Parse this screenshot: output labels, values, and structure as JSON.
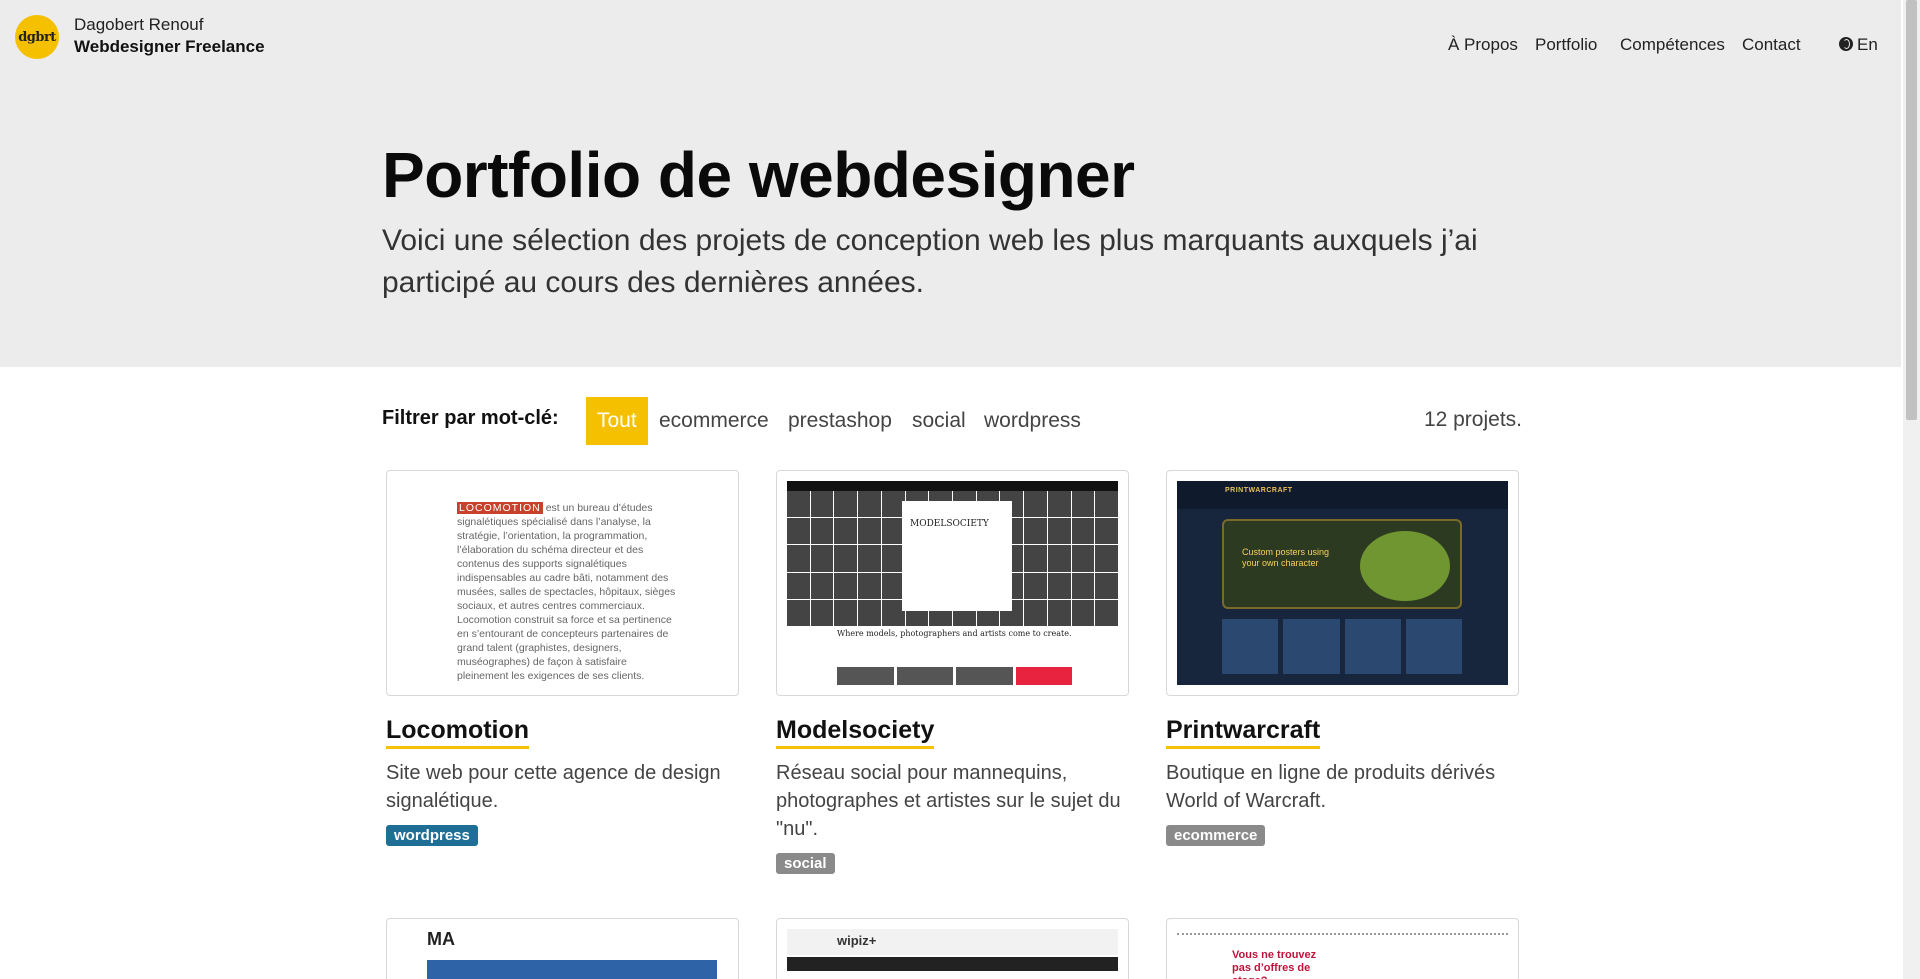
{
  "brand": {
    "logo_text": "dgbrt",
    "name": "Dagobert Renouf",
    "role": "Webdesigner Freelance"
  },
  "nav": {
    "items": [
      {
        "label": "À Propos"
      },
      {
        "label": "Portfolio"
      },
      {
        "label": "Compétences"
      },
      {
        "label": "Contact"
      }
    ],
    "language": {
      "label": "En",
      "icon": "globe-icon"
    }
  },
  "hero": {
    "title": "Portfolio de webdesigner",
    "subtitle": "Voici une sélection des projets de conception web les plus marquants auxquels j’ai participé au cours des dernières années."
  },
  "filters": {
    "label": "Filtrer par mot-clé:",
    "options": [
      {
        "label": "Tout",
        "active": true
      },
      {
        "label": "ecommerce",
        "active": false
      },
      {
        "label": "prestashop",
        "active": false
      },
      {
        "label": "social",
        "active": false
      },
      {
        "label": "wordpress",
        "active": false
      }
    ],
    "count": "12 projets."
  },
  "projects": [
    {
      "title": "Locomotion",
      "description": "Site web pour cette agence de design signalétique.",
      "tag": "wordpress",
      "tag_color": "#1e6e96",
      "thumb_brand": "LOCOMOTION",
      "thumb_text": "est un bureau d’études signalétiques spécialisé dans l’analyse, la stratégie, l’orientation, la programmation, l’élaboration du schéma directeur et des contenus des supports signalétiques indispensables au cadre bâti, notamment des musées, salles de spectacles, hôpitaux, sièges sociaux, et autres centres commerciaux. Locomotion construit sa force et sa pertinence en s’entourant de concepteurs partenaires de grand talent (graphistes, designers, muséographes) de façon à satisfaire pleinement les exigences de ses clients."
    },
    {
      "title": "Modelsociety",
      "description": "Réseau social pour mannequins, photographes et artistes sur le sujet du \"nu\".",
      "tag": "social",
      "tag_color": "#8a8a8a",
      "thumb_logo": "MODELSOCIETY",
      "thumb_tagline": "Where models, photographers and artists come to create."
    },
    {
      "title": "Printwarcraft",
      "description": "Boutique en ligne de produits dérivés World of Warcraft.",
      "tag": "ecommerce",
      "tag_color": "#8a8a8a",
      "thumb_logo": "PRINTWARCRAFT",
      "thumb_headline": "Custom posters using your own character"
    }
  ],
  "partial_projects": [
    {
      "thumb_logo": "MA"
    },
    {
      "thumb_logo": "wipiz+"
    },
    {
      "thumb_headline": "Vous ne trouvez pas d’offres de stage?"
    }
  ],
  "colors": {
    "accent": "#f5c000",
    "header_bg": "#ececec",
    "tag_wordpress": "#1e6e96",
    "tag_default": "#8a8a8a"
  }
}
